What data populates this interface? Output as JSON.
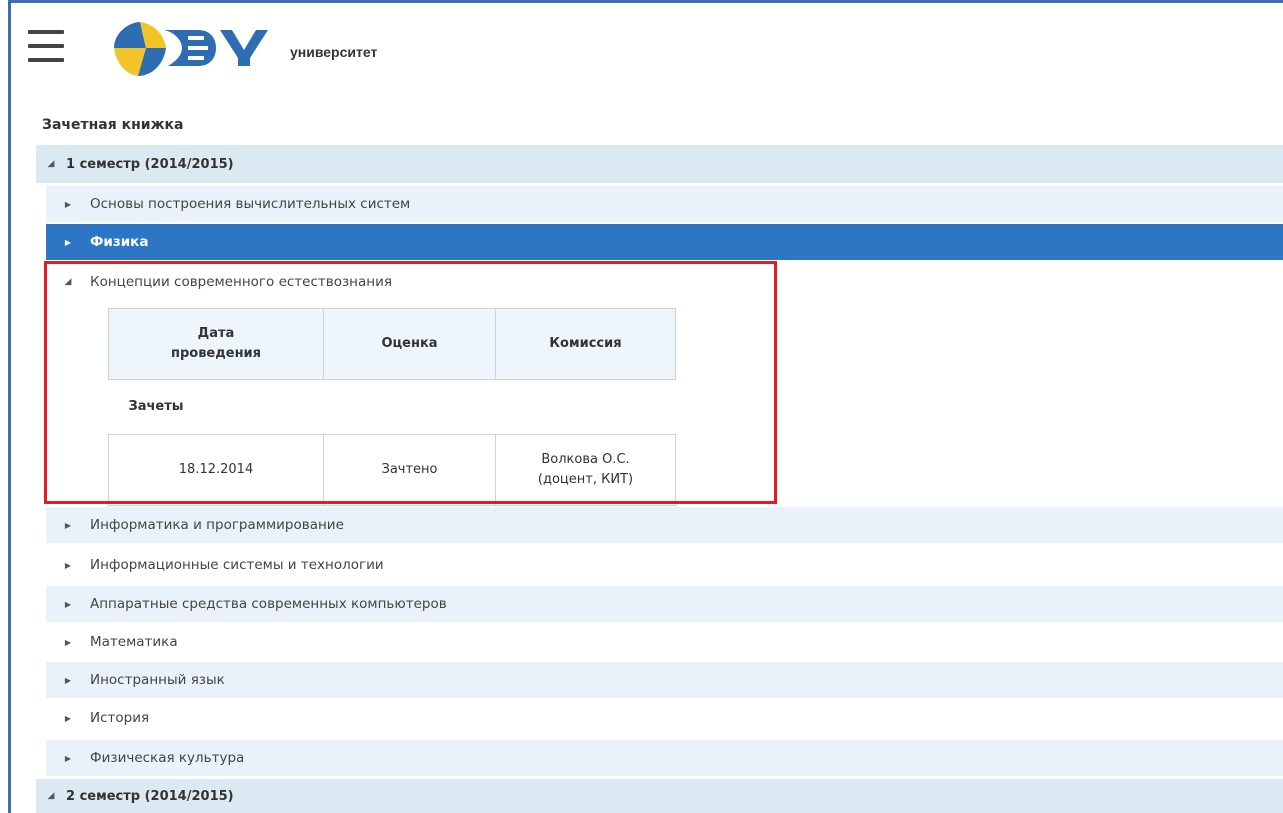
{
  "header": {
    "menu_icon": "hamburger-menu-icon",
    "logo_icon": "university-logo",
    "logo_text": "университет"
  },
  "page_title": "Зачетная книжка",
  "semesters": [
    {
      "label": "1 семестр (2014/2015)",
      "expanded": true,
      "subjects": [
        {
          "label": "Основы построения вычислительных систем",
          "expanded": false
        },
        {
          "label": "Физика",
          "expanded": false,
          "selected": true
        },
        {
          "label": "Концепции современного естествознания",
          "expanded": true
        },
        {
          "label": "Информатика и программирование",
          "expanded": false
        },
        {
          "label": "Информационные системы и технологии",
          "expanded": false
        },
        {
          "label": "Аппаратные средства современных компьютеров",
          "expanded": false
        },
        {
          "label": "Математика",
          "expanded": false
        },
        {
          "label": "Иностранный язык",
          "expanded": false
        },
        {
          "label": "История",
          "expanded": false
        },
        {
          "label": "Физическая культура",
          "expanded": false
        }
      ]
    },
    {
      "label": "2 семестр (2014/2015)",
      "expanded": true
    }
  ],
  "grade_table": {
    "headers": {
      "date": "Дата\nпроведения",
      "grade": "Оценка",
      "commission": "Комиссия"
    },
    "section_label": "Зачеты",
    "rows": [
      {
        "date": "18.12.2014",
        "grade": "Зачтено",
        "commission": "Волкова О.С.\n(доцент, КИТ)"
      }
    ]
  },
  "colors": {
    "accent": "#2d76c4",
    "frame": "#3d6fb0",
    "row_tint": "#e9f2fa",
    "semester_bg": "#dbe9f3",
    "highlight": "#e21c24"
  }
}
